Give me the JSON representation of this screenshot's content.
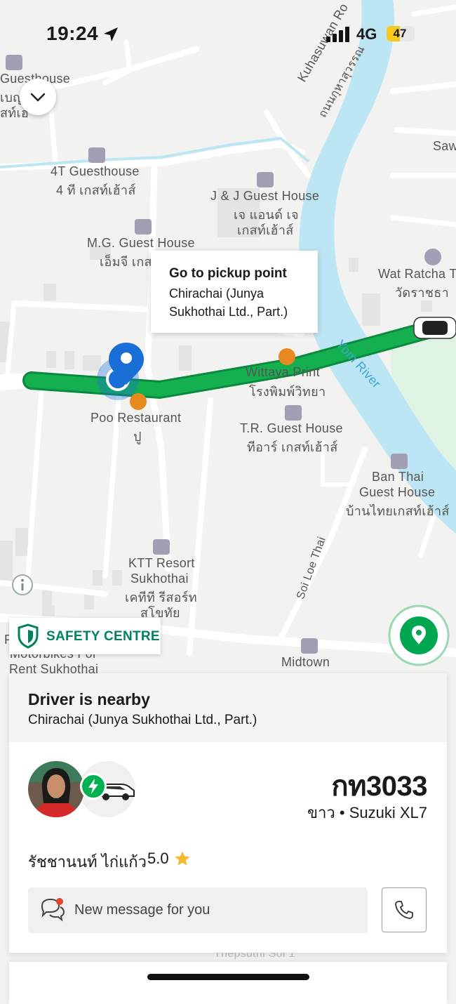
{
  "status_bar": {
    "time": "19:24",
    "network": "4G",
    "battery": "47",
    "battery_level": 0.47
  },
  "map": {
    "labels": {
      "guesthouse_top": "Guesthouse",
      "guesthouse_top_th1": "เบญ",
      "guesthouse_top_th2": "สท์เฮ",
      "kuhasuwan_en": "Kuhasuwan Ro",
      "kuhasuwan_th": "ถนนกุหาสุวรรณ",
      "saw": "Saw",
      "t4_en": "4T Guesthouse",
      "t4_th": "4 ที เกสท์เฮ้าส์",
      "jj_en": "J & J Guest House",
      "jj_th1": "เจ แอนด์ เจ",
      "jj_th2": "เกสท์เฮ้าส์",
      "mg_en": "M.G. Guest House",
      "mg_th": "เอ็มจี เกส",
      "wat_en": "Wat Ratcha T",
      "wat_th": "วัดราชธา",
      "wittaya_en": "Wittaya Print",
      "wittaya_th": "โรงพิมพ์วิทยา",
      "yom_river": "Yom River",
      "poo_en": "Poo Restaurant",
      "poo_th": "ปู",
      "tr_en": "T.R. Guest House",
      "tr_th": "ทีอาร์ เกสท์เฮ้าส์",
      "banthai_en1": "Ban Thai",
      "banthai_en2": "Guest House",
      "banthai_th": "บ้านไทยเกสท์เฮ้าส์",
      "soi_loe_thai": "Soi Loe Thai",
      "ktt_en1": "KTT Resort",
      "ktt_en2": "Sukhothai",
      "ktt_th1": "เคทีที รีสอร์ท",
      "ktt_th2": "สุโขทัย",
      "motorbikes1": "Motorbikes For",
      "motorbikes2": "Rent Sukhothai",
      "midtown": "Midtown",
      "thepsuthi": "Thepsuthi Soi 1",
      "p_letter": "P"
    },
    "callout": {
      "title": "Go to pickup point",
      "address": "Chirachai (Junya Sukhothai Ltd., Part.)"
    },
    "safety_label": "SAFETY CENTRE"
  },
  "sheet": {
    "status_title": "Driver is nearby",
    "pickup_address": "Chirachai (Junya Sukhothai Ltd., Part.)",
    "plate": "กท3033",
    "vehicle": "ขาว • Suzuki XL7",
    "driver_name": "รัชชานนท์ ไก่แก้ว",
    "rating": "5.0",
    "message_placeholder": "New message for you"
  },
  "colors": {
    "route": "#0aa14a",
    "brand": "#00b14f",
    "river": "#bde6f5",
    "pin": "#1a6fd6"
  },
  "icons": [
    "navigation-arrow-icon",
    "signal-icon",
    "chevron-down-icon",
    "pin-icon",
    "shield-icon",
    "info-icon",
    "location-icon",
    "bolt-icon",
    "car-icon",
    "star-icon",
    "chat-icon",
    "phone-icon"
  ]
}
